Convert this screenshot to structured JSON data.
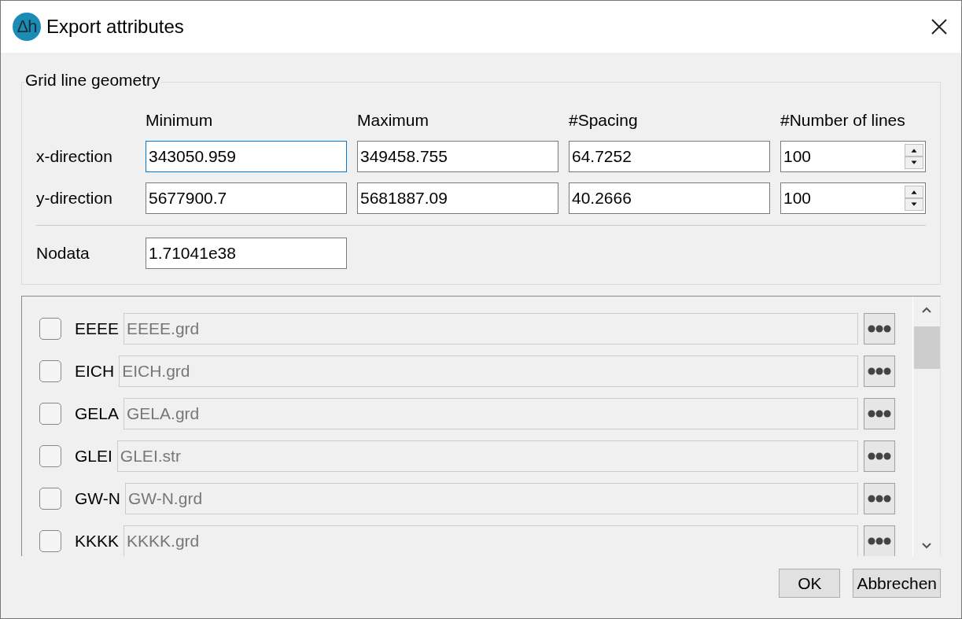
{
  "window": {
    "title": "Export attributes",
    "logo_text": "Δh"
  },
  "grid_geometry": {
    "legend": "Grid line geometry",
    "columns": [
      "Minimum",
      "Maximum",
      "#Spacing",
      "#Number of lines"
    ],
    "rows": [
      {
        "label": "x-direction",
        "minimum": {
          "value": "343050.959",
          "focused": true
        },
        "maximum": {
          "value": "349458.755",
          "focused": false
        },
        "spacing": {
          "value": "64.7252",
          "focused": false
        },
        "number_of_lines": "100"
      },
      {
        "label": "y-direction",
        "minimum": {
          "value": "5677900.7",
          "focused": false
        },
        "maximum": {
          "value": "5681887.09",
          "focused": false
        },
        "spacing": {
          "value": "40.2666",
          "focused": false
        },
        "number_of_lines": "100"
      }
    ],
    "nodata": {
      "label": "Nodata",
      "value": "1.71041e38"
    }
  },
  "attributes": [
    {
      "name": "EEEE",
      "file": "EEEE.grd",
      "checked": false
    },
    {
      "name": "EICH",
      "file": "EICH.grd",
      "checked": false
    },
    {
      "name": "GELA",
      "file": "GELA.grd",
      "checked": false
    },
    {
      "name": "GLEI",
      "file": "GLEI.str",
      "checked": false
    },
    {
      "name": "GW-N",
      "file": "GW-N.grd",
      "checked": false
    },
    {
      "name": "KKKK",
      "file": "KKKK.grd",
      "checked": false
    }
  ],
  "buttons": [
    "OK",
    "Abbrechen"
  ]
}
